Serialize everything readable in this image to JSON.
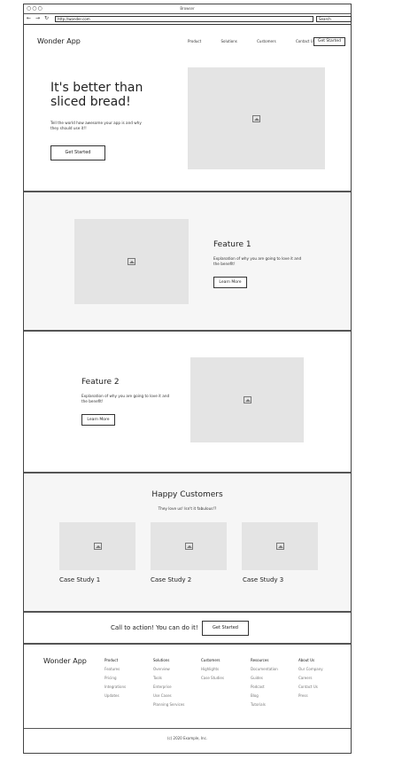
{
  "window": {
    "title": "Browser",
    "url": "http://wonder.com",
    "search_placeholder": "Search"
  },
  "nav": {
    "logo": "Wonder App",
    "links": [
      "Product",
      "Solutions",
      "Customers",
      "Contact Us"
    ],
    "cta": "Get Started"
  },
  "hero": {
    "title": "It's better than sliced bread!",
    "text": "Tell the world how awesome your app is and why they should use it!!",
    "button": "Get Started"
  },
  "feature1": {
    "title": "Feature 1",
    "text": "Explanation of why you are going to love it and the benefit!",
    "button": "Learn More"
  },
  "feature2": {
    "title": "Feature 2",
    "text": "Explanation of why you are going to love it and the benefit!",
    "button": "Learn More"
  },
  "customers": {
    "title": "Happy Customers",
    "subtitle": "They love us! Isn't it fabulous!?",
    "cases": [
      "Case Study 1",
      "Case Study 2",
      "Case Study 3"
    ]
  },
  "cta": {
    "text": "Call to action! You can do it!",
    "button": "Get Started"
  },
  "footer": {
    "logo": "Wonder App",
    "columns": [
      {
        "heading": "Product",
        "items": [
          "Features",
          "Pricing",
          "Integrations",
          "Updates"
        ]
      },
      {
        "heading": "Solutions",
        "items": [
          "Overview",
          "Tools",
          "Enterprise",
          "Use Cases",
          "Planning Services"
        ]
      },
      {
        "heading": "Customers",
        "items": [
          "Highlights",
          "Case Studies"
        ]
      },
      {
        "heading": "Resources",
        "items": [
          "Documentation",
          "Guides",
          "Podcast",
          "Blog",
          "Tutorials"
        ]
      },
      {
        "heading": "About Us",
        "items": [
          "Our Company",
          "Careers",
          "Contact Us",
          "Press"
        ]
      }
    ],
    "copyright": "(c) 2020 Example, Inc."
  }
}
